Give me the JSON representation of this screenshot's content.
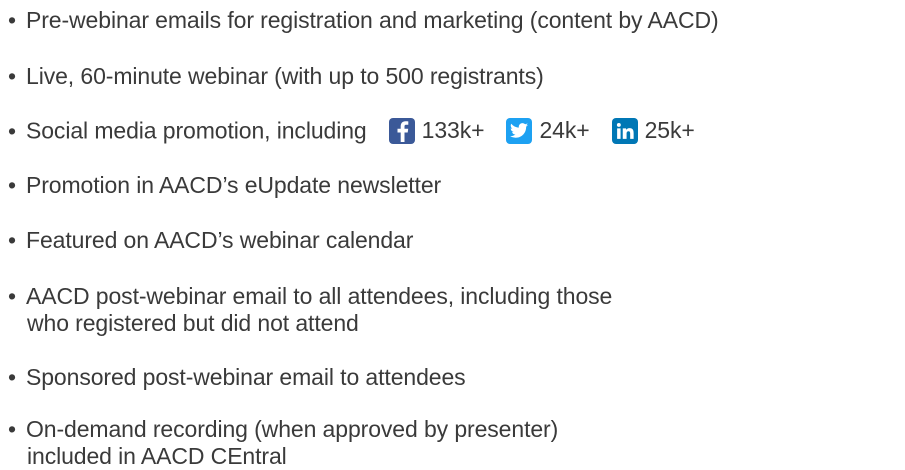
{
  "bullet_char": "•",
  "items": [
    {
      "line1": "Pre-webinar emails for registration and marketing (content by AACD)"
    },
    {
      "line1": "Live, 60-minute webinar (with up to 500 registrants)"
    },
    {
      "line1": "Social media promotion, including"
    },
    {
      "line1": "Promotion in AACD’s eUpdate newsletter"
    },
    {
      "line1": "Featured on AACD’s webinar calendar"
    },
    {
      "line1": "AACD post-webinar email to all attendees, including those",
      "line2": "who registered but did not attend"
    },
    {
      "line1": "Sponsored post-webinar email to attendees"
    },
    {
      "line1": "On-demand recording (when approved by presenter)",
      "line2": "included in AACD CEntral"
    }
  ],
  "social": {
    "facebook": {
      "icon": "facebook-icon",
      "count": "133k+",
      "color": "#3b5998"
    },
    "twitter": {
      "icon": "twitter-icon",
      "count": "24k+",
      "color": "#1da1f2"
    },
    "linkedin": {
      "icon": "linkedin-icon",
      "count": "25k+",
      "color": "#0077b5"
    }
  }
}
